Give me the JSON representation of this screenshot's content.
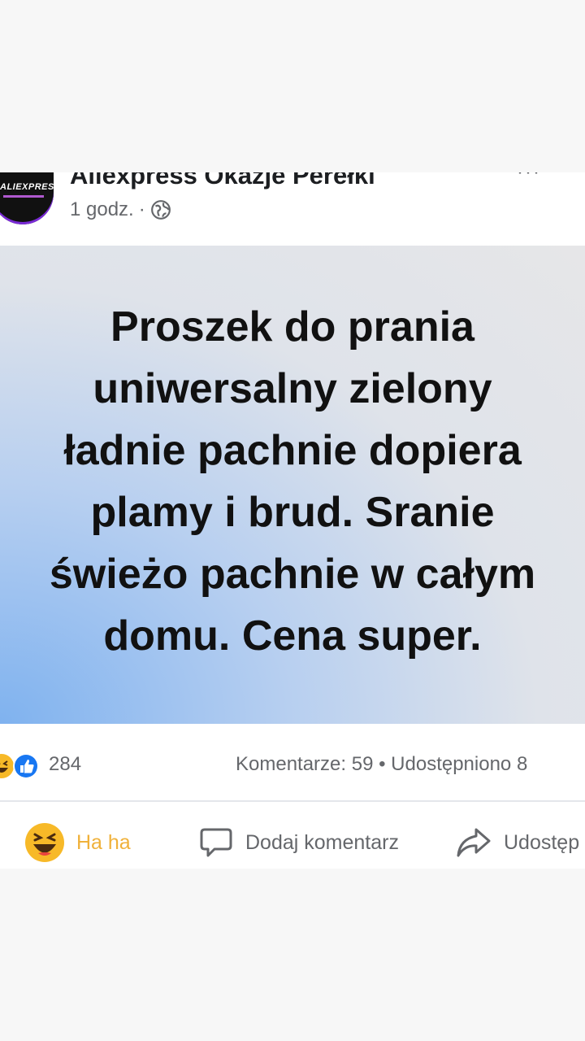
{
  "post": {
    "page_name": "Aliexpress Okazje Perełki",
    "avatar_text": "ALIEXPRESS",
    "time": "1 godz.",
    "separator": "·",
    "more": "···"
  },
  "banner": {
    "text": "Proszek do prania\nuniwersalny zielony\nładnie pachnie dopiera\nplamy i brud. Sranie\nświeżo pachnie w całym\ndomu. Cena super.",
    "colors": {
      "gradient_blue": "#7fb2ef",
      "gradient_grey": "#e6e6e8"
    }
  },
  "stats": {
    "reactions": [
      "haha-icon",
      "like-icon"
    ],
    "reaction_count": "284",
    "comments_shares": "Komentarze: 59 • Udostępniono 8"
  },
  "actions": {
    "haha_label": "Ha ha",
    "comment_label": "Dodaj komentarz",
    "share_label": "Udostęp"
  },
  "colors": {
    "text_secondary": "#65676b",
    "haha": "#f0b13a",
    "like": "#1877f2"
  }
}
